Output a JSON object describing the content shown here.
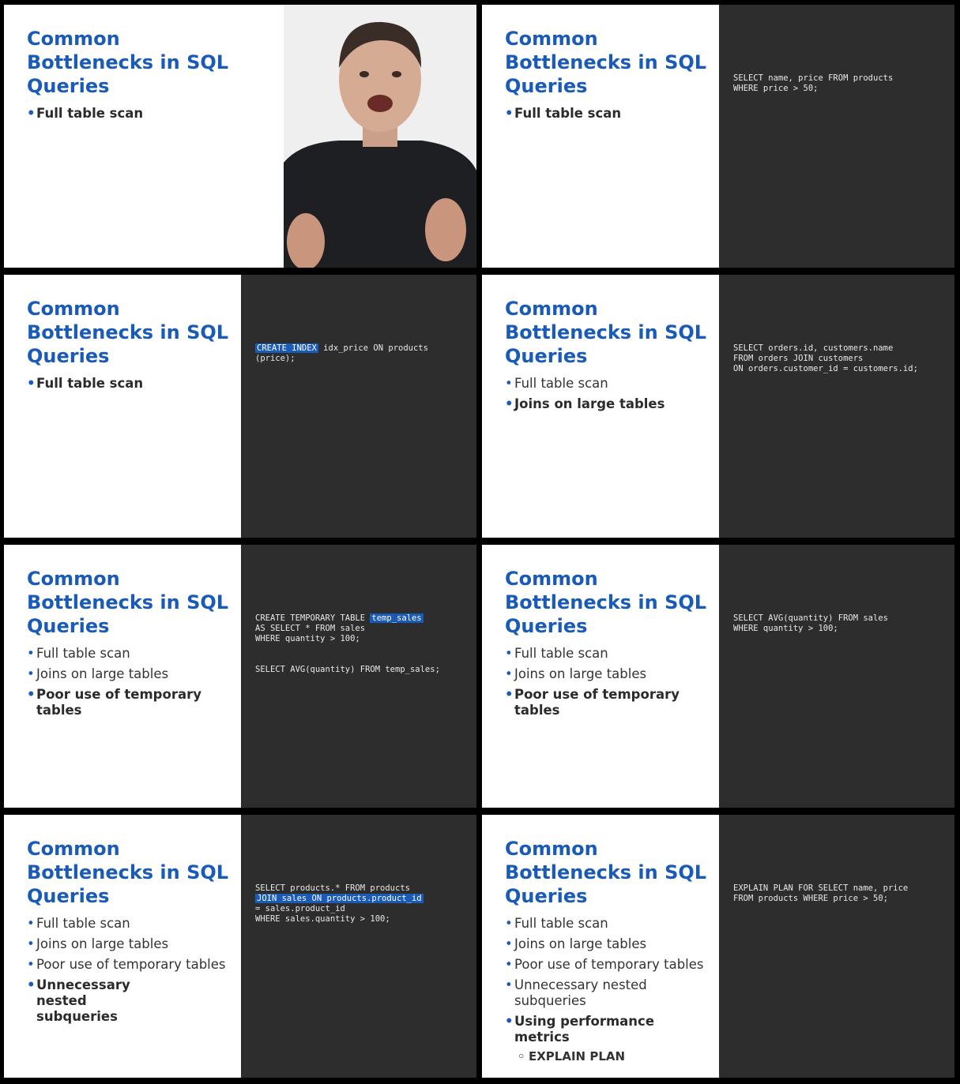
{
  "colors": {
    "title": "#1a5bb8",
    "code_bg": "#2d2d2d",
    "highlight": "#1a5bb8"
  },
  "slides": [
    {
      "title": "Common Bottlenecks in SQL Queries",
      "bullets": [
        "Full table scan"
      ],
      "video_alt": "presenter-video"
    },
    {
      "title": "Common Bottlenecks in SQL Queries",
      "bullets": [
        "Full table scan"
      ],
      "code": [
        "SELECT name, price FROM products",
        "WHERE price > 50;"
      ]
    },
    {
      "title": "Common Bottlenecks in SQL Queries",
      "bullets": [
        "Full table scan"
      ],
      "code_hl": "CREATE INDEX",
      "code_rest": " idx_price ON products",
      "code2": "(price);"
    },
    {
      "title": "Common Bottlenecks in SQL Queries",
      "bullets": [
        "Full table scan",
        "Joins on large tables"
      ],
      "code": [
        "SELECT orders.id, customers.name",
        "FROM orders JOIN customers",
        "ON orders.customer_id = customers.id;"
      ]
    },
    {
      "title": "Common Bottlenecks in SQL Queries",
      "bullets": [
        "Full table scan",
        "Joins on large tables",
        "Poor use of temporary tables"
      ],
      "code_pre": "CREATE TEMPORARY TABLE ",
      "code_hl": "temp_sales",
      "code_lines": [
        "AS SELECT * FROM sales",
        "WHERE quantity > 100;",
        "",
        "",
        "SELECT AVG(quantity) FROM temp_sales;"
      ]
    },
    {
      "title": "Common Bottlenecks in SQL Queries",
      "bullets": [
        "Full table scan",
        "Joins on large tables",
        "Poor use of temporary tables"
      ],
      "code": [
        "SELECT AVG(quantity) FROM sales",
        "WHERE quantity > 100;"
      ]
    },
    {
      "title": "Common Bottlenecks in SQL Queries",
      "bullets": [
        "Full table scan",
        "Joins on large tables",
        "Poor use of temporary tables",
        "Unnecessary nested subqueries"
      ],
      "code_pre": "SELECT products.* FROM products",
      "code_hl": "JOIN sales ON products.product_id",
      "code_lines": [
        "= sales.product_id",
        "WHERE sales.quantity > 100;"
      ]
    },
    {
      "title": "Common Bottlenecks in SQL Queries",
      "bullets": [
        "Full table scan",
        "Joins on large tables",
        "Poor use of temporary tables",
        "Unnecessary nested subqueries",
        "Using performance metrics"
      ],
      "sub_bullet": "EXPLAIN PLAN",
      "code": [
        "EXPLAIN PLAN FOR SELECT name, price",
        "FROM products WHERE price > 50;"
      ]
    }
  ]
}
